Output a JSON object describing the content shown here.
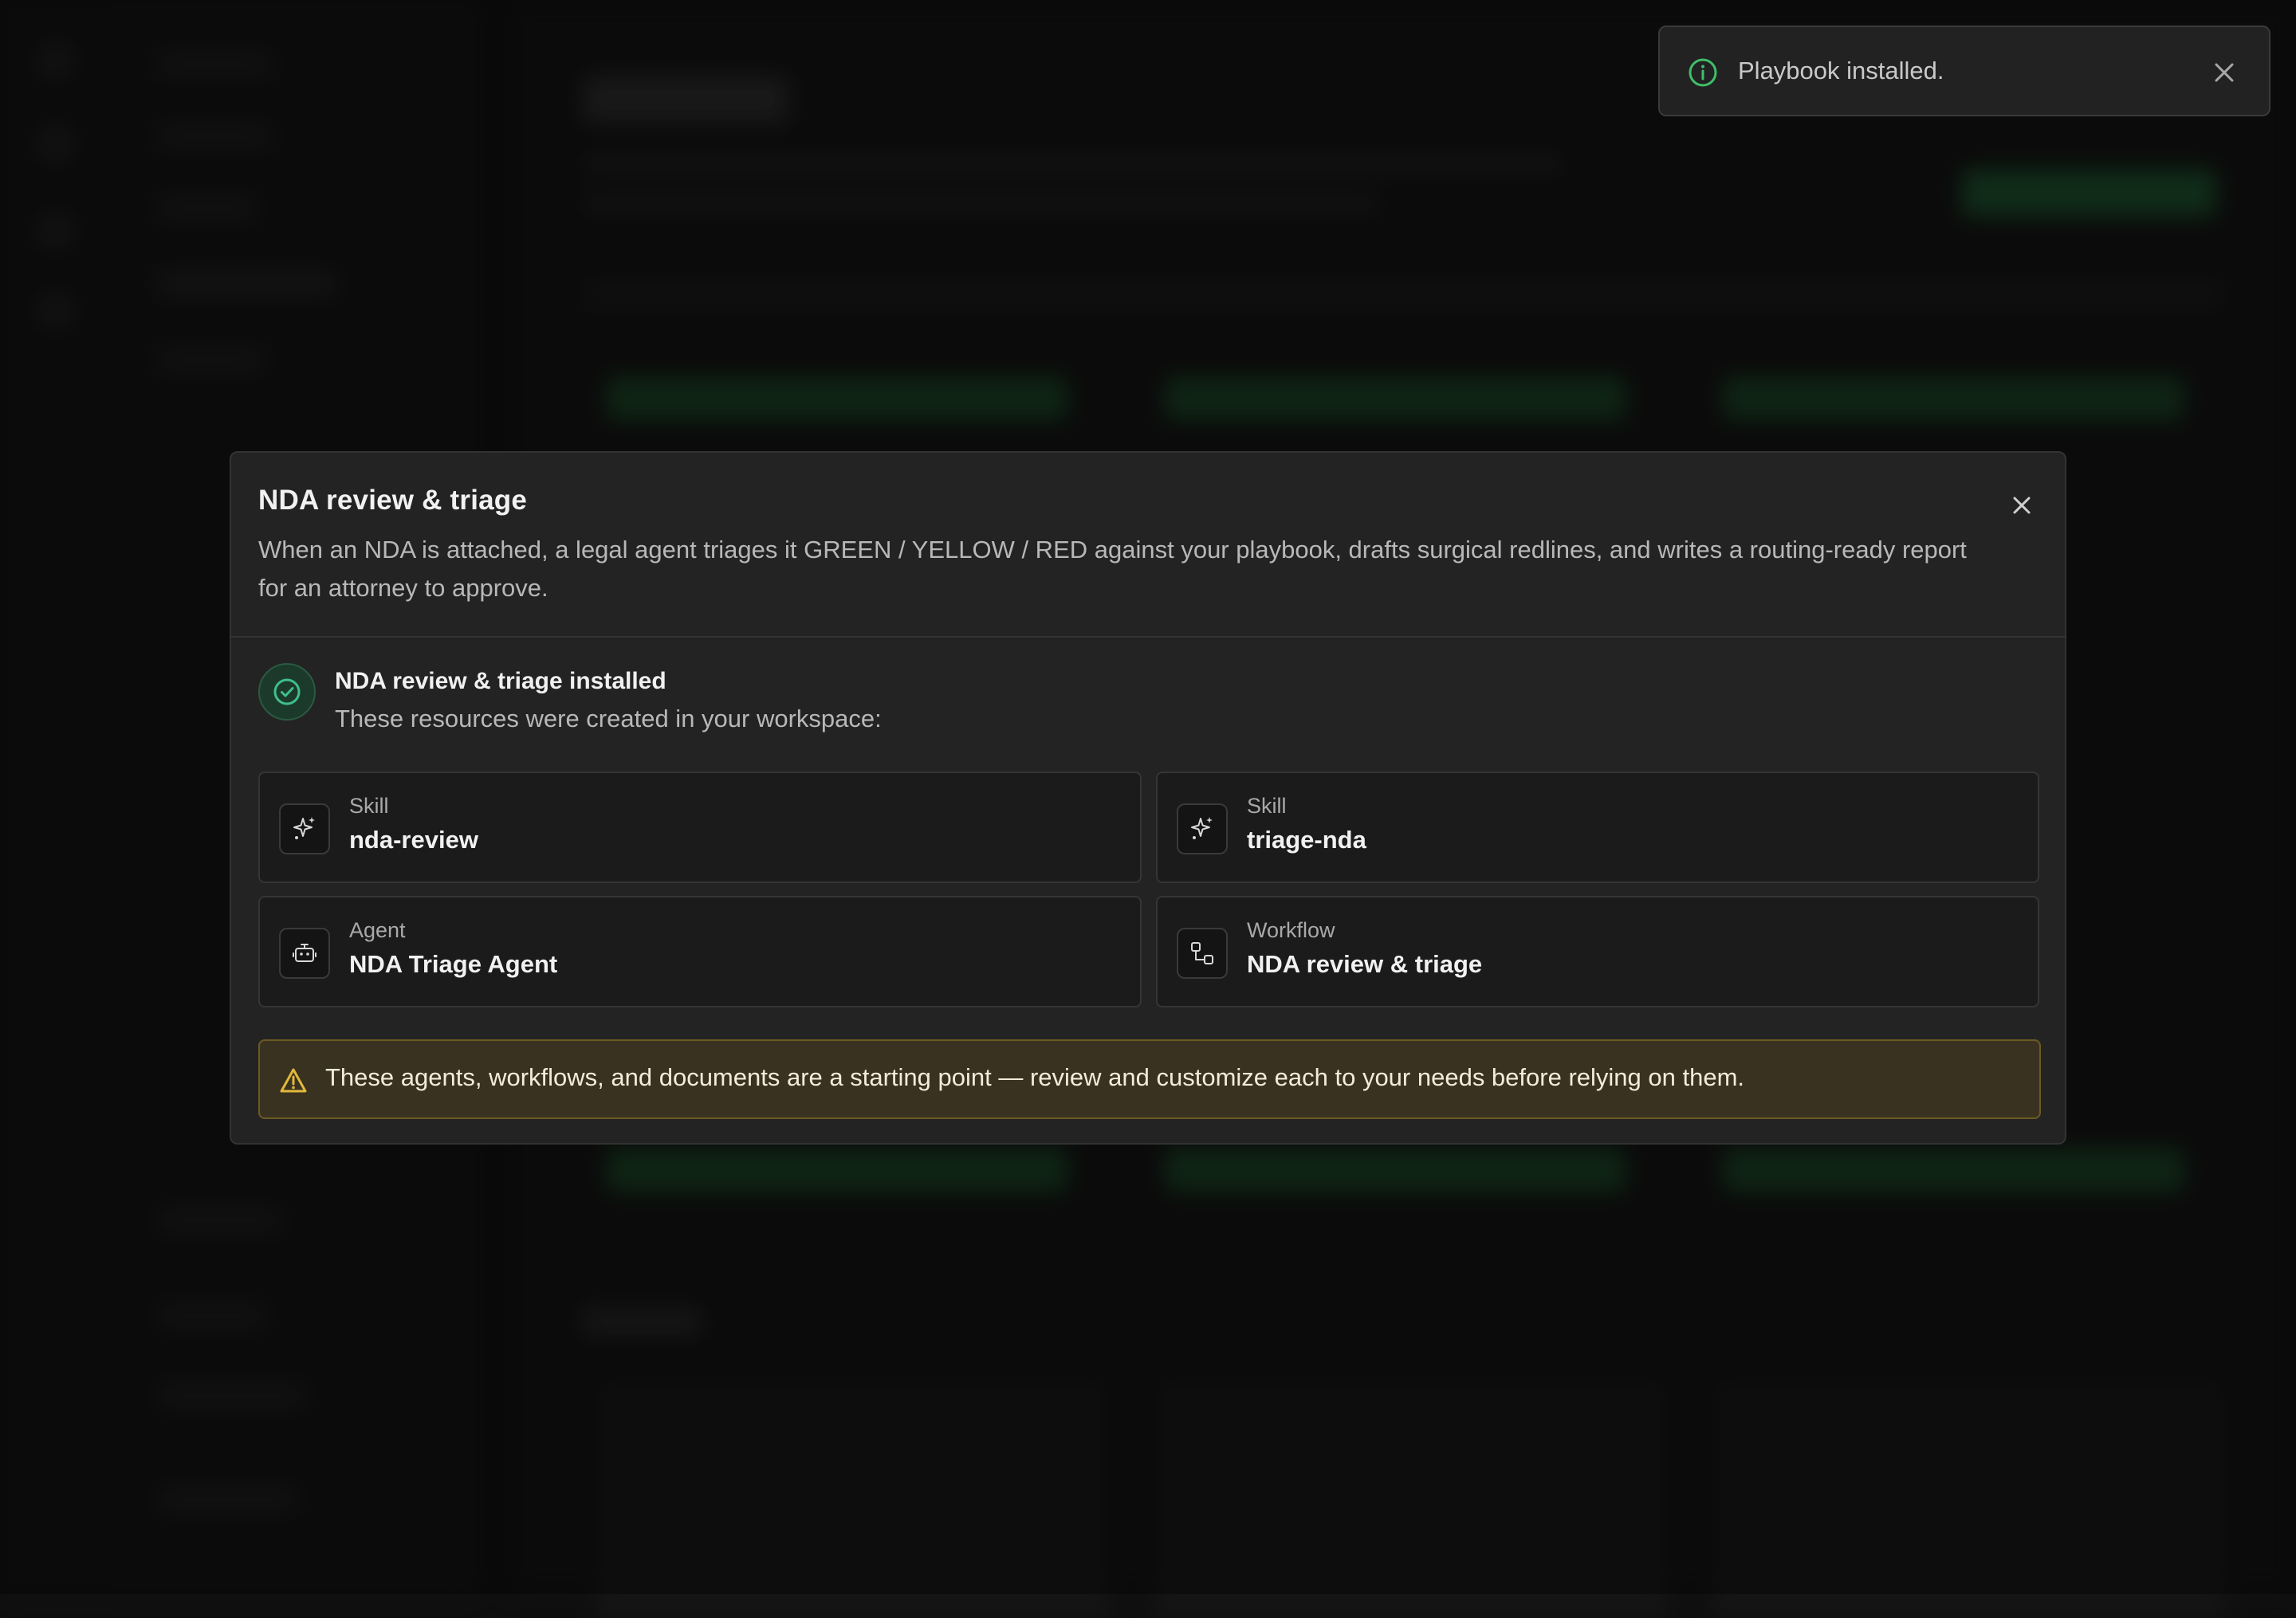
{
  "toast": {
    "message": "Playbook installed.",
    "icon": "info-icon",
    "accent": "#3fbf6a"
  },
  "modal": {
    "title": "NDA review & triage",
    "description": "When an NDA is attached, a legal agent triages it GREEN / YELLOW / RED against your playbook, drafts surgical redlines, and writes a routing-ready report for an attorney to approve.",
    "success": {
      "title": "NDA review & triage installed",
      "subtitle": "These resources were created in your workspace:",
      "icon": "check-circle-icon",
      "accent": "#3fbf8a"
    },
    "resources": [
      {
        "type": "Skill",
        "name": "nda-review",
        "icon": "sparkles-icon"
      },
      {
        "type": "Skill",
        "name": "triage-nda",
        "icon": "sparkles-icon"
      },
      {
        "type": "Agent",
        "name": "NDA Triage Agent",
        "icon": "bot-icon"
      },
      {
        "type": "Workflow",
        "name": "NDA review & triage",
        "icon": "workflow-icon"
      }
    ],
    "warning": {
      "text": "These agents, workflows, and documents are a starting point — review and customize each to your needs before relying on them.",
      "icon": "warning-triangle-icon",
      "accent": "#e2b93b"
    }
  }
}
